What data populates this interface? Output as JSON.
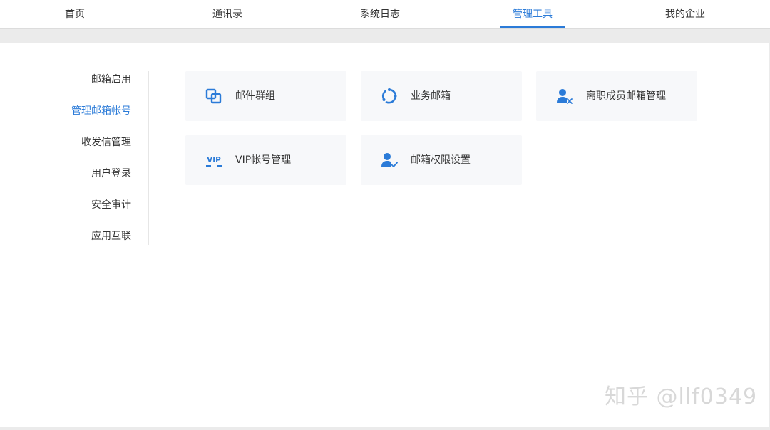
{
  "nav": {
    "tabs": [
      {
        "label": "首页"
      },
      {
        "label": "通讯录"
      },
      {
        "label": "系统日志"
      },
      {
        "label": "管理工具"
      },
      {
        "label": "我的企业"
      }
    ],
    "active_tab": "管理工具"
  },
  "sidebar": {
    "items": [
      {
        "label": "邮箱启用"
      },
      {
        "label": "管理邮箱帐号"
      },
      {
        "label": "收发信管理"
      },
      {
        "label": "用户登录"
      },
      {
        "label": "安全审计"
      },
      {
        "label": "应用互联"
      }
    ],
    "active_item": "管理邮箱帐号"
  },
  "cards": [
    {
      "label": "邮件群组",
      "icon": "mail-group-icon"
    },
    {
      "label": "业务邮箱",
      "icon": "business-mailbox-icon"
    },
    {
      "label": "离职成员邮箱管理",
      "icon": "departed-member-icon"
    },
    {
      "label": "VIP帐号管理",
      "icon": "vip-icon"
    },
    {
      "label": "邮箱权限设置",
      "icon": "user-check-icon"
    }
  ],
  "watermark": "知乎 @llf0349",
  "colors": {
    "accent": "#2b7bd8",
    "card_bg": "#f7f8fa",
    "page_bg": "#ebebeb"
  }
}
